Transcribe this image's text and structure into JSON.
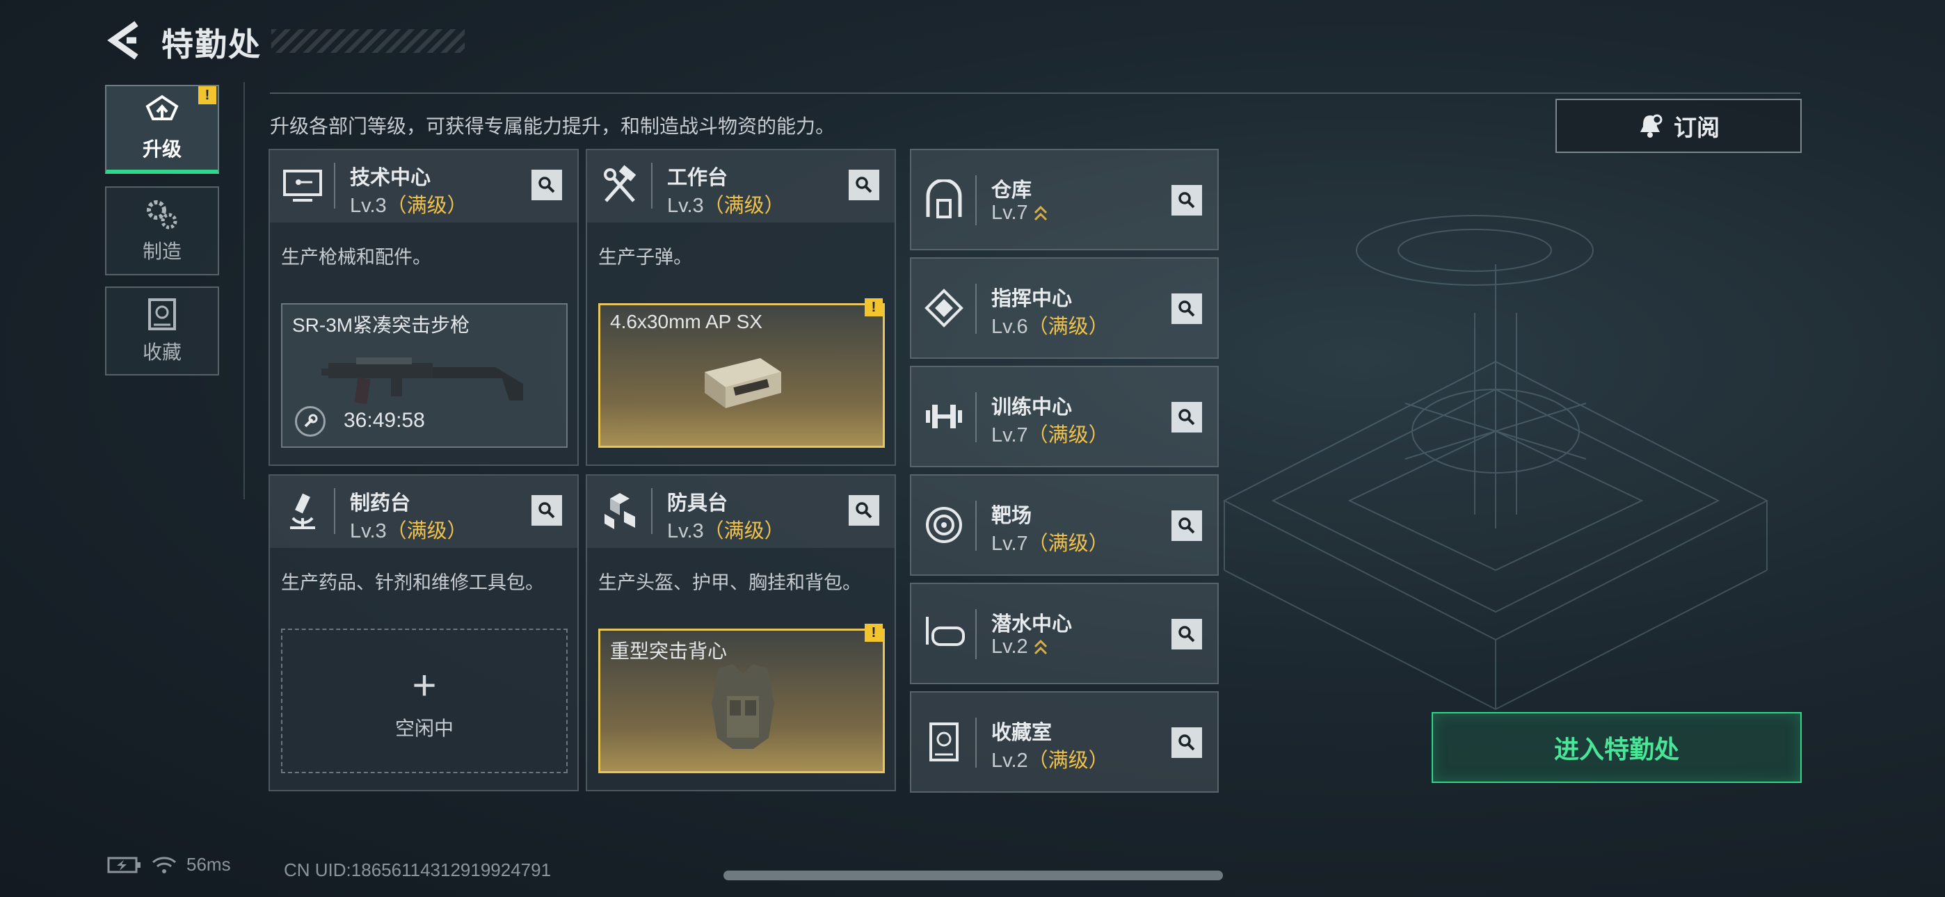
{
  "header": {
    "title": "特勤处"
  },
  "description": "升级各部门等级，可获得专属能力提升，和制造战斗物资的能力。",
  "sidebar": {
    "items": [
      {
        "label": "升级",
        "active": true,
        "badge": "!"
      },
      {
        "label": "制造",
        "active": false
      },
      {
        "label": "收藏",
        "active": false
      }
    ]
  },
  "departments": [
    {
      "name": "技术中心",
      "level": "Lv.3",
      "max": "（满级）",
      "desc": "生产枪械和配件。",
      "slot": {
        "title": "SR-3M紧凑突击步枪",
        "timer": "36:49:58"
      }
    },
    {
      "name": "工作台",
      "level": "Lv.3",
      "max": "（满级）",
      "desc": "生产子弹。",
      "slot": {
        "title": "4.6x30mm AP SX",
        "badge": "!"
      }
    },
    {
      "name": "制药台",
      "level": "Lv.3",
      "max": "（满级）",
      "desc": "生产药品、针剂和维修工具包。",
      "slot": {
        "plus": "+",
        "idle": "空闲中"
      }
    },
    {
      "name": "防具台",
      "level": "Lv.3",
      "max": "（满级）",
      "desc": "生产头盔、护甲、胸挂和背包。",
      "slot": {
        "title": "重型突击背心",
        "badge": "!"
      }
    }
  ],
  "right_list": [
    {
      "name": "仓库",
      "level": "Lv.7",
      "max": "",
      "upgradable": true
    },
    {
      "name": "指挥中心",
      "level": "Lv.6",
      "max": "（满级）"
    },
    {
      "name": "训练中心",
      "level": "Lv.7",
      "max": "（满级）"
    },
    {
      "name": "靶场",
      "level": "Lv.7",
      "max": "（满级）"
    },
    {
      "name": "潜水中心",
      "level": "Lv.2",
      "max": "",
      "upgradable": true
    },
    {
      "name": "收藏室",
      "level": "Lv.2",
      "max": "（满级）"
    }
  ],
  "buttons": {
    "subscribe": "订阅",
    "enter": "进入特勤处"
  },
  "footer": {
    "ping": "56ms",
    "uid": "CN UID:18656114312919924791"
  },
  "colors": {
    "accent_green": "#31d68b",
    "max_gold": "#f0c24b",
    "warn_yellow": "#f2c42d"
  }
}
